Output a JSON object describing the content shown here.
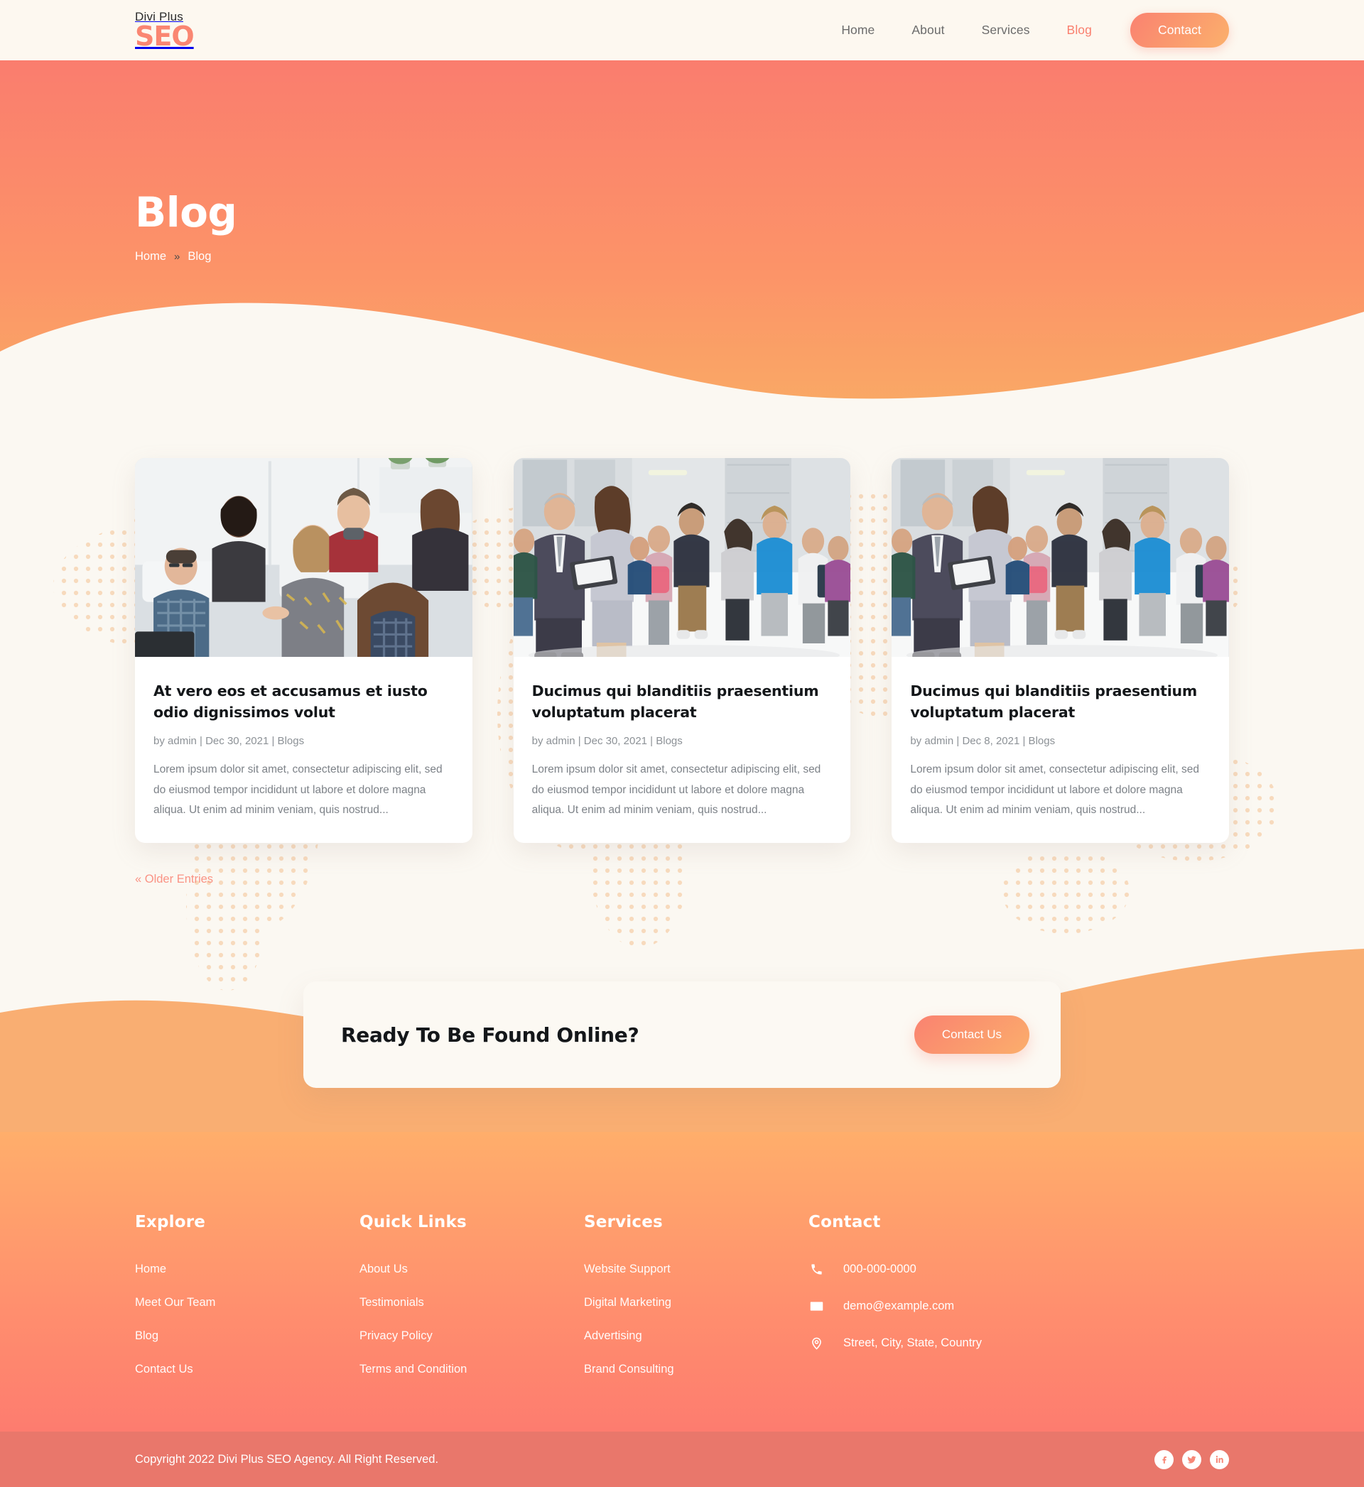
{
  "header": {
    "logo_top": "Divi Plus",
    "logo_main": "SEO",
    "nav": [
      {
        "label": "Home",
        "active": false
      },
      {
        "label": "About",
        "active": false
      },
      {
        "label": "Services",
        "active": false
      },
      {
        "label": "Blog",
        "active": true
      }
    ],
    "contact_button": "Contact"
  },
  "hero": {
    "title": "Blog",
    "breadcrumb": {
      "home": "Home",
      "separator": "»",
      "current": "Blog"
    }
  },
  "blog": {
    "posts": [
      {
        "title": "At vero eos et accusamus et iusto odio dignissimos volut",
        "meta": "by admin | Dec 30, 2021 | Blogs",
        "author": "admin",
        "date": "Dec 30, 2021",
        "category": "Blogs",
        "excerpt": "Lorem ipsum dolor sit amet, consectetur adipiscing elit, sed do eiusmod tempor incididunt ut labore et dolore magna aliqua. Ut enim ad minim veniam, quis nostrud...",
        "image": "office-meeting-photo"
      },
      {
        "title": "Ducimus qui blanditiis praesentium voluptatum placerat",
        "meta": "by admin | Dec 30, 2021 | Blogs",
        "author": "admin",
        "date": "Dec 30, 2021",
        "category": "Blogs",
        "excerpt": "Lorem ipsum dolor sit amet, consectetur adipiscing elit, sed do eiusmod tempor incididunt ut labore et dolore magna aliqua. Ut enim ad minim veniam, quis nostrud...",
        "image": "business-plaza-photo"
      },
      {
        "title": "Ducimus qui blanditiis praesentium voluptatum placerat",
        "meta": "by admin | Dec 8, 2021 | Blogs",
        "author": "admin",
        "date": "Dec 8, 2021",
        "category": "Blogs",
        "excerpt": "Lorem ipsum dolor sit amet, consectetur adipiscing elit, sed do eiusmod tempor incididunt ut labore et dolore magna aliqua. Ut enim ad minim veniam, quis nostrud...",
        "image": "business-plaza-photo"
      }
    ],
    "older_entries": "« Older Entries"
  },
  "cta": {
    "title": "Ready To Be Found Online?",
    "button": "Contact Us"
  },
  "footer": {
    "columns": [
      {
        "heading": "Explore",
        "links": [
          "Home",
          "Meet Our Team",
          "Blog",
          "Contact Us"
        ]
      },
      {
        "heading": "Quick Links",
        "links": [
          "About Us",
          "Testimonials",
          "Privacy Policy",
          "Terms and Condition"
        ]
      },
      {
        "heading": "Services",
        "links": [
          "Website Support",
          "Digital Marketing",
          "Advertising",
          "Brand Consulting"
        ]
      }
    ],
    "contact": {
      "heading": "Contact",
      "phone": "000-000-0000",
      "email": "demo@example.com",
      "address": "Street, City, State, Country"
    }
  },
  "copyright": {
    "text": "Copyright 2022 Divi Plus SEO Agency. All Right Reserved.",
    "socials": [
      "facebook-icon",
      "twitter-icon",
      "linkedin-icon"
    ]
  },
  "colors": {
    "accent_salmon": "#FA7F6E",
    "accent_orange": "#F9A965",
    "header_bg": "#FDF8F0",
    "page_bg": "#FBF8F2",
    "copybar_bg": "#E9776B",
    "title_dark": "#14171A",
    "body_text": "#7D8288"
  }
}
